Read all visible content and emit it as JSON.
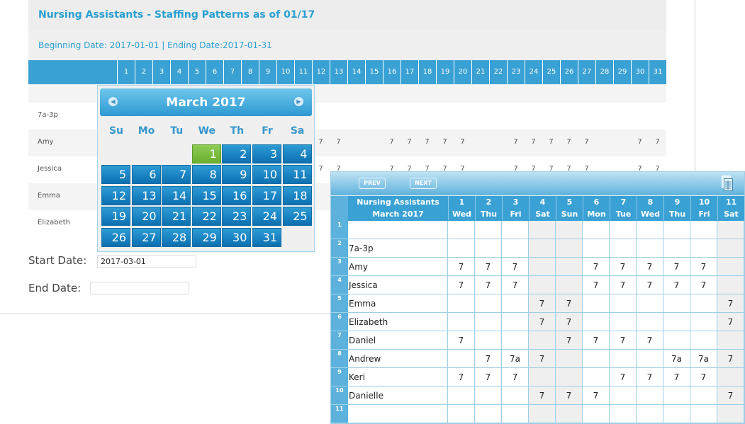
{
  "back_window": {
    "title": "Nursing Assistants - Staffing Patterns as of 01/17",
    "date_range": "Beginning Date: 2017-01-01 | Ending Date:2017-01-31",
    "day_headers": [
      "1",
      "2",
      "3",
      "4",
      "5",
      "6",
      "7",
      "8",
      "9",
      "10",
      "11",
      "12",
      "13",
      "14",
      "15",
      "16",
      "17",
      "18",
      "19",
      "20",
      "21",
      "22",
      "23",
      "24",
      "25",
      "26",
      "27",
      "28",
      "29",
      "30",
      "31"
    ],
    "rows": [
      {
        "name": "",
        "cells": {}
      },
      {
        "name": "7a-3p",
        "cells": {}
      },
      {
        "name": "Amy",
        "cells": {
          "12": "7",
          "13": "7",
          "16": "7",
          "17": "7",
          "18": "7",
          "19": "7",
          "20": "7",
          "23": "7",
          "24": "7",
          "25": "7",
          "26": "7",
          "27": "7",
          "30": "7",
          "31": "7"
        }
      },
      {
        "name": "Jessica",
        "cells": {
          "12": "7",
          "13": "7",
          "16": "7",
          "17": "7",
          "18": "7",
          "19": "7",
          "20": "7",
          "23": "7",
          "24": "7",
          "25": "7",
          "26": "7",
          "27": "7",
          "30": "7",
          "31": "7"
        }
      },
      {
        "name": "Emma",
        "cells": {}
      },
      {
        "name": "Elizabeth",
        "cells": {}
      }
    ],
    "start_date_label": "Start Date:",
    "start_date_value": "2017-03-01",
    "end_date_label": "End Date:",
    "end_date_value": ""
  },
  "calendar": {
    "title": "March 2017",
    "prev_icon": "prev-month-icon",
    "next_icon": "next-month-icon",
    "weekdays": [
      "Su",
      "Mo",
      "Tu",
      "We",
      "Th",
      "Fr",
      "Sa"
    ],
    "first_weekday_index": 3,
    "days_in_month": 31,
    "selected_day": 1
  },
  "spreadsheet": {
    "prev_label": "PREV",
    "next_label": "NEXT",
    "sheet_icon": "spreadsheet-icon",
    "header_row1_title": "Nursing Assistants",
    "header_row2_title": "March 2017",
    "day_numbers": [
      "1",
      "2",
      "3",
      "4",
      "5",
      "6",
      "7",
      "8",
      "9",
      "10",
      "11"
    ],
    "weekdays": [
      "Wed",
      "Thu",
      "Fri",
      "Sat",
      "Sun",
      "Mon",
      "Tue",
      "Wed",
      "Thu",
      "Fri",
      "Sat"
    ],
    "weekend_columns": [
      3,
      4,
      10
    ],
    "row_numbers": [
      "1",
      "2",
      "3",
      "4",
      "5",
      "6",
      "7",
      "8",
      "9",
      "10",
      "11"
    ],
    "rows": [
      {
        "name": "",
        "cells": [
          "",
          "",
          "",
          "",
          "",
          "",
          "",
          "",
          "",
          "",
          ""
        ]
      },
      {
        "name": "7a-3p",
        "cells": [
          "",
          "",
          "",
          "",
          "",
          "",
          "",
          "",
          "",
          "",
          ""
        ]
      },
      {
        "name": "Amy",
        "cells": [
          "7",
          "7",
          "7",
          "",
          "",
          "7",
          "7",
          "7",
          "7",
          "7",
          ""
        ]
      },
      {
        "name": "Jessica",
        "cells": [
          "7",
          "7",
          "7",
          "",
          "",
          "7",
          "7",
          "7",
          "7",
          "7",
          ""
        ]
      },
      {
        "name": "Emma",
        "cells": [
          "",
          "",
          "",
          "7",
          "7",
          "",
          "",
          "",
          "",
          "",
          "7"
        ]
      },
      {
        "name": "Elizabeth",
        "cells": [
          "",
          "",
          "",
          "7",
          "7",
          "",
          "",
          "",
          "",
          "",
          "7"
        ]
      },
      {
        "name": "Daniel",
        "cells": [
          "7",
          "",
          "",
          "",
          "7",
          "7",
          "7",
          "7",
          "",
          "",
          ""
        ]
      },
      {
        "name": "Andrew",
        "cells": [
          "",
          "7",
          "7a",
          "7",
          "",
          "",
          "",
          "",
          "7a",
          "7a",
          "7"
        ]
      },
      {
        "name": "Keri",
        "cells": [
          "7",
          "7",
          "7",
          "",
          "",
          "",
          "7",
          "7",
          "7",
          "7",
          ""
        ]
      },
      {
        "name": "Danielle",
        "cells": [
          "",
          "",
          "",
          "7",
          "7",
          "7",
          "",
          "",
          "",
          "",
          "7"
        ]
      },
      {
        "name": "",
        "cells": [
          "",
          "",
          "",
          "",
          "",
          "",
          "",
          "",
          "",
          "",
          ""
        ]
      }
    ]
  },
  "colors": {
    "accent": "#3aa1d4",
    "title_blue": "#2aa0d1",
    "calendar_day": "#1c86c5",
    "calendar_today": "#78b83c"
  }
}
